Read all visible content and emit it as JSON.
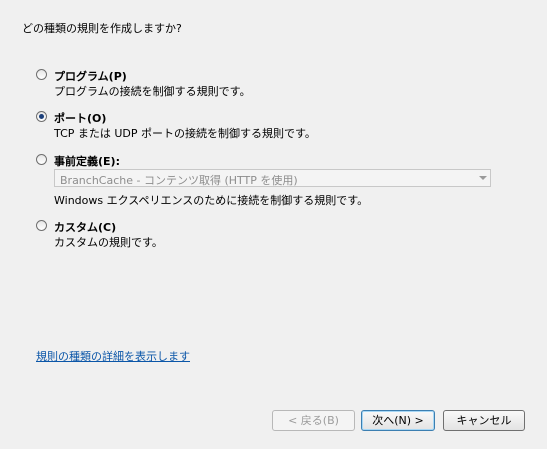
{
  "question": "どの種類の規則を作成しますか?",
  "options": [
    {
      "label": "プログラム(P)",
      "description": "プログラムの接続を制御する規則です。",
      "selected": false
    },
    {
      "label": "ポート(O)",
      "description": "TCP または UDP ポートの接続を制御する規則です。",
      "selected": true
    },
    {
      "label": "事前定義(E):",
      "dropdown_value": "BranchCache - コンテンツ取得 (HTTP を使用)",
      "description": "Windows エクスペリエンスのために接続を制御する規則です。",
      "selected": false
    },
    {
      "label": "カスタム(C)",
      "description": "カスタムの規則です。",
      "selected": false
    }
  ],
  "link": "規則の種類の詳細を表示します",
  "buttons": {
    "back": "< 戻る(B)",
    "next": "次へ(N) >",
    "cancel": "キャンセル"
  }
}
